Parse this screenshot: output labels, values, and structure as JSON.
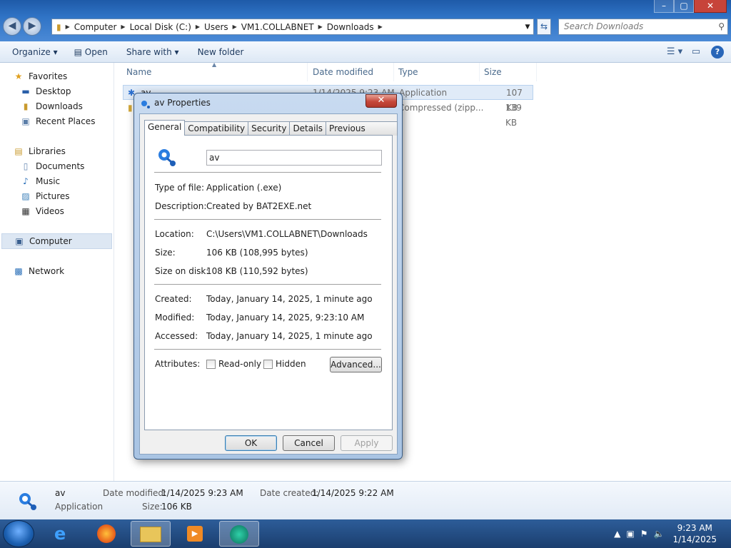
{
  "window": {
    "controls": [
      "–",
      "▢",
      "✕"
    ]
  },
  "address": {
    "segments": [
      "Computer",
      "Local Disk (C:)",
      "Users",
      "VM1.COLLABNET",
      "Downloads"
    ],
    "search_placeholder": "Search Downloads"
  },
  "toolbar": {
    "organize": "Organize ▾",
    "open": "Open",
    "share": "Share with ▾",
    "new_folder": "New folder"
  },
  "navpane": {
    "favorites": "Favorites",
    "desktop": "Desktop",
    "downloads": "Downloads",
    "recent": "Recent Places",
    "libraries": "Libraries",
    "documents": "Documents",
    "music": "Music",
    "pictures": "Pictures",
    "videos": "Videos",
    "computer": "Computer",
    "network": "Network"
  },
  "columns": {
    "name": "Name",
    "date": "Date modified",
    "type": "Type",
    "size": "Size"
  },
  "files": [
    {
      "name": "av",
      "date": "1/14/2025 9:23 AM",
      "type": "Application",
      "size": "107 KB"
    },
    {
      "name": "",
      "date": "",
      "type": "Compressed (zipp...",
      "size": "139 KB"
    }
  ],
  "details": {
    "name": "av",
    "type": "Application",
    "date_modified_label": "Date modified:",
    "date_modified": "1/14/2025 9:23 AM",
    "date_created_label": "Date created:",
    "date_created": "1/14/2025 9:22 AM",
    "size_label": "Size:",
    "size": "106 KB"
  },
  "dialog": {
    "title": "av Properties",
    "close": "✕",
    "tabs": [
      "General",
      "Compatibility",
      "Security",
      "Details",
      "Previous Versions"
    ],
    "filename": "av",
    "labels": {
      "type": "Type of file:",
      "description": "Description:",
      "location": "Location:",
      "size": "Size:",
      "size_on_disk": "Size on disk:",
      "created": "Created:",
      "modified": "Modified:",
      "accessed": "Accessed:",
      "attributes": "Attributes:"
    },
    "values": {
      "type": "Application (.exe)",
      "description": "Created by BAT2EXE.net",
      "location": "C:\\Users\\VM1.COLLABNET\\Downloads",
      "size": "106 KB (108,995 bytes)",
      "size_on_disk": "108 KB (110,592 bytes)",
      "created": "Today, January 14, 2025, 1 minute ago",
      "modified": "Today, January 14, 2025, 9:23:10 AM",
      "accessed": "Today, January 14, 2025, 1 minute ago"
    },
    "readonly": "Read-only",
    "hidden": "Hidden",
    "advanced": "Advanced...",
    "ok": "OK",
    "cancel": "Cancel",
    "apply": "Apply"
  },
  "taskbar": {
    "time": "9:23 AM",
    "date": "1/14/2025"
  }
}
